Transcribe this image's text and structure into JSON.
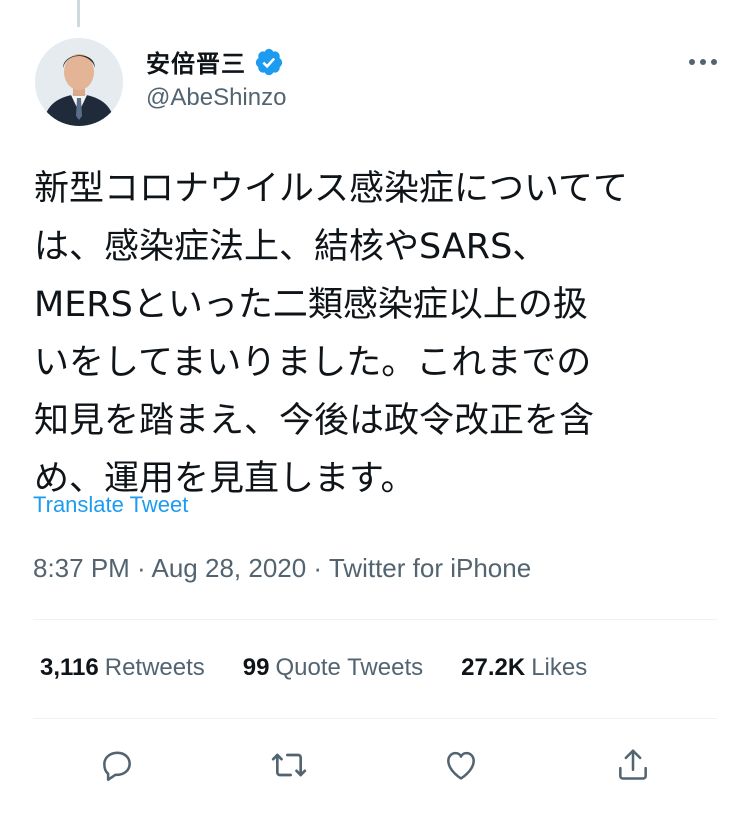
{
  "author": {
    "display_name": "安倍晋三",
    "handle": "@AbeShinzo",
    "verified": true
  },
  "tweet": {
    "lines": [
      "新型コロナウイルス感染症についてては、感染症法上、結核やSARS、",
      "MERSといった二類感染症以上の扱",
      "いをしてまいりました。これまでの",
      "知見を踏まえ、今後は政令改正を含",
      "め、運用を見直します。"
    ]
  },
  "translate_label": "Translate Tweet",
  "meta": {
    "time": "8:37 PM",
    "separator1": " · ",
    "date": "Aug 28, 2020",
    "separator2": " · ",
    "source": "Twitter for iPhone"
  },
  "stats": {
    "retweets": {
      "count": "3,116",
      "label": "Retweets"
    },
    "quotes": {
      "count": "99",
      "label": "Quote Tweets"
    },
    "likes": {
      "count": "27.2K",
      "label": "Likes"
    }
  },
  "icons": {
    "reply": "reply-icon",
    "retweet": "retweet-icon",
    "like": "heart-icon",
    "share": "share-icon",
    "more": "more-icon",
    "verified": "verified-badge-icon"
  },
  "colors": {
    "link": "#1d9bf0",
    "secondary_text": "#536471",
    "primary_text": "#0f1419",
    "divider": "#eff3f4"
  }
}
